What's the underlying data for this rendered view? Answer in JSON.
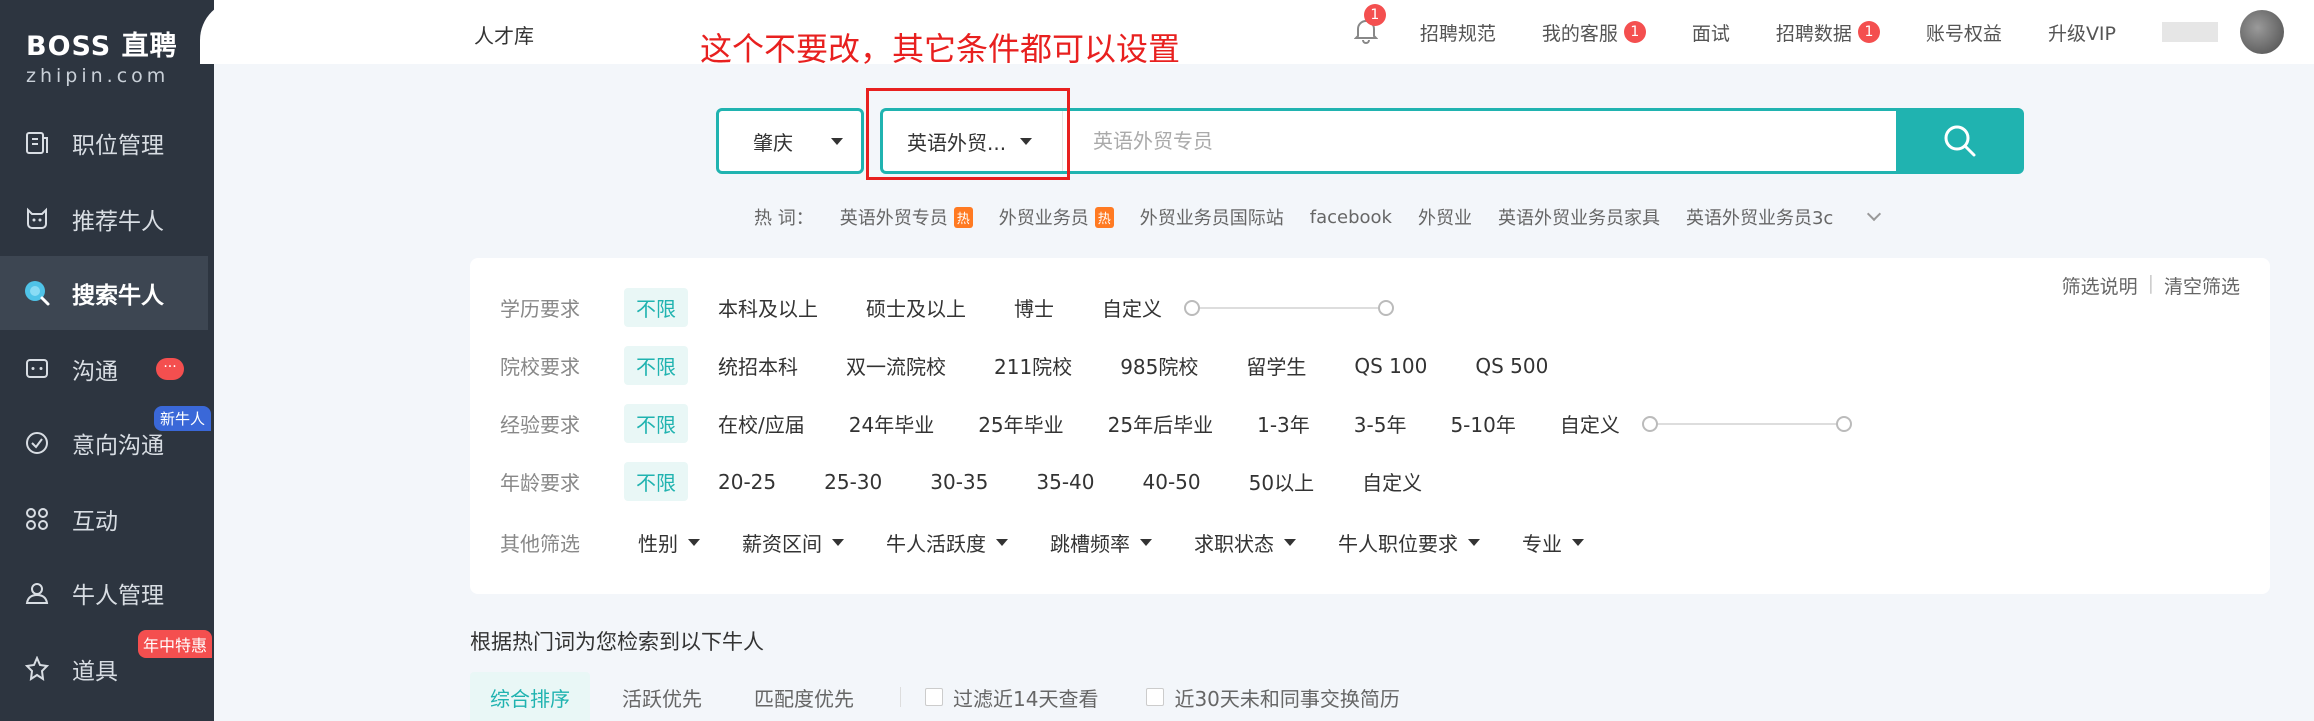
{
  "logo": {
    "brand": "BOSS 直聘",
    "domain": "zhipin.com"
  },
  "sidebar": {
    "items": [
      {
        "label": "职位管理",
        "icon": "job-manage-icon"
      },
      {
        "label": "推荐牛人",
        "icon": "recommend-icon"
      },
      {
        "label": "搜索牛人",
        "icon": "search-talent-icon",
        "active": true
      },
      {
        "label": "沟通",
        "icon": "chat-icon",
        "badge": "···"
      },
      {
        "label": "意向沟通",
        "icon": "intent-chat-icon",
        "tag": "新牛人"
      },
      {
        "label": "互动",
        "icon": "interact-icon"
      },
      {
        "label": "牛人管理",
        "icon": "talent-manage-icon"
      },
      {
        "label": "道具",
        "icon": "tools-icon",
        "tag": "年中特惠"
      }
    ]
  },
  "header": {
    "title": "人才库",
    "annotation": "这个不要改，其它条件都可以设置",
    "bell_count": "1",
    "links": [
      {
        "label": "招聘规范"
      },
      {
        "label": "我的客服",
        "count": "1"
      },
      {
        "label": "面试"
      },
      {
        "label": "招聘数据",
        "count": "1"
      },
      {
        "label": "账号权益"
      },
      {
        "label": "升级VIP"
      }
    ]
  },
  "search": {
    "city": "肇庆",
    "job_select": "英语外贸...",
    "placeholder": "英语外贸专员"
  },
  "hot": {
    "label": "热 词：",
    "hot_tag": "热",
    "words": [
      "英语外贸专员",
      "外贸业务员",
      "外贸业务员国际站",
      "facebook",
      "外贸业",
      "英语外贸业务员家具",
      "英语外贸业务员3c"
    ]
  },
  "filters": {
    "explain": "筛选说明",
    "clear": "清空筛选",
    "education": {
      "label": "学历要求",
      "options": [
        "不限",
        "本科及以上",
        "硕士及以上",
        "博士",
        "自定义"
      ]
    },
    "school": {
      "label": "院校要求",
      "options": [
        "不限",
        "统招本科",
        "双一流院校",
        "211院校",
        "985院校",
        "留学生",
        "QS 100",
        "QS 500"
      ]
    },
    "experience": {
      "label": "经验要求",
      "options": [
        "不限",
        "在校/应届",
        "24年毕业",
        "25年毕业",
        "25年后毕业",
        "1-3年",
        "3-5年",
        "5-10年",
        "自定义"
      ]
    },
    "age": {
      "label": "年龄要求",
      "options": [
        "不限",
        "20-25",
        "25-30",
        "30-35",
        "35-40",
        "40-50",
        "50以上",
        "自定义"
      ]
    },
    "other": {
      "label": "其他筛选",
      "options": [
        "性别",
        "薪资区间",
        "牛人活跃度",
        "跳槽频率",
        "求职状态",
        "牛人职位要求",
        "专业"
      ]
    }
  },
  "results": {
    "title": "根据热门词为您检索到以下牛人",
    "sorts": [
      "综合排序",
      "活跃优先",
      "匹配度优先"
    ],
    "checks": [
      "过滤近14天查看",
      "近30天未和同事交换简历"
    ]
  },
  "colors": {
    "accent": "#20b3b0",
    "sidebar": "#2d3540",
    "annotation": "#e8201f",
    "badge": "#f44f4f"
  }
}
